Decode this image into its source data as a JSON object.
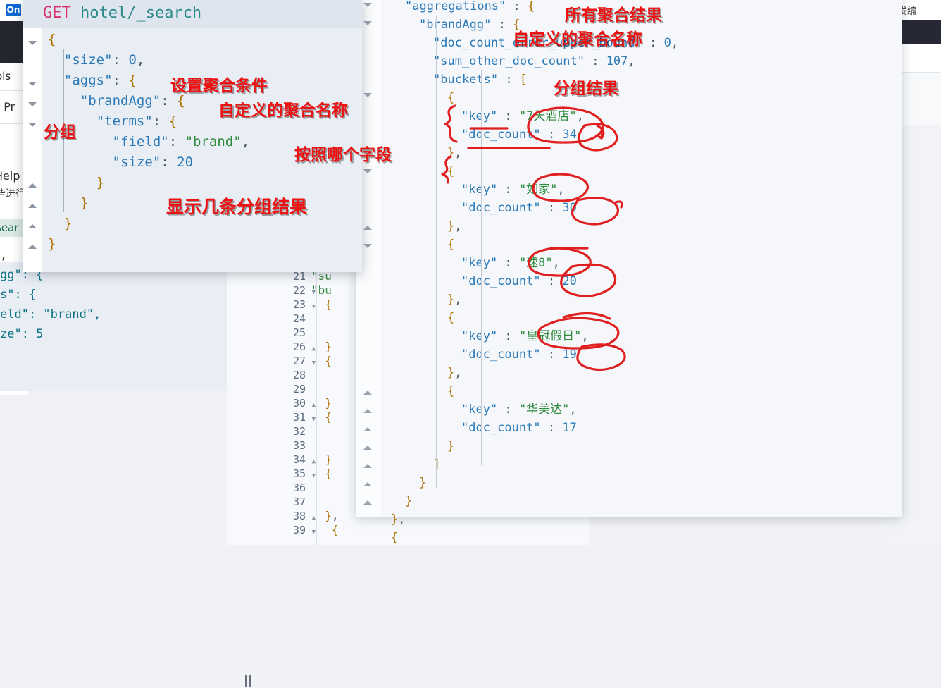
{
  "background_left_window": {
    "badge_label": "On",
    "menu_tools": "ols",
    "menu_profiler": "h Pr",
    "help_label": "Help",
    "cn_text": "些进行",
    "highlight_text": "sear",
    "comma": ","
  },
  "background_right_window": {
    "tab_label": "并发编"
  },
  "request_window": {
    "title_method": "GET",
    "title_path": " hotel/_search",
    "lines": [
      "{",
      "  \"size\": 0,",
      "  \"aggs\": {",
      "    \"brandAgg\": {",
      "      \"terms\": {",
      "        \"field\": \"brand\",",
      "        \"size\": 20",
      "      }",
      "    }",
      "  }",
      "}"
    ],
    "field_value": "brand",
    "size_value": "20",
    "top_size_value": "0"
  },
  "left_code_fragment": {
    "lines": [
      "gg\": {",
      "s\": {",
      "eld\": \"brand\",",
      "ze\": 5"
    ],
    "size_value": "5",
    "field_value": "brand"
  },
  "center_editor": {
    "line_numbers": [
      "21",
      "22",
      "23",
      "24",
      "25",
      "26",
      "27",
      "28",
      "29",
      "30",
      "31",
      "32",
      "33",
      "34",
      "35",
      "36",
      "37",
      "38",
      "39"
    ],
    "fold_markers": {
      "22": "down",
      "23": "down",
      "26": "up",
      "27": "down",
      "30": "up",
      "31": "down",
      "34": "up",
      "35": "down",
      "38": "up",
      "39": "down"
    },
    "code_lines": [
      "\"su",
      "\"bu",
      "  {",
      "",
      "",
      "  }",
      "  {",
      "",
      "",
      "  }",
      "  {",
      "",
      "",
      "  }",
      "  {",
      "",
      "",
      "  },",
      "   {"
    ]
  },
  "response": {
    "aggregations_key": "\"aggregations\"",
    "brand_agg_key": "\"brandAgg\"",
    "doc_count_error_upper_bound_key": "\"doc_count_error_upper_bound\"",
    "doc_count_error_upper_bound_value": "0",
    "sum_other_doc_count_key": "\"sum_other_doc_count\"",
    "sum_other_doc_count_value": "107",
    "buckets_key": "\"buckets\"",
    "key_label": "\"key\"",
    "doc_count_label": "\"doc_count\"",
    "buckets": [
      {
        "key": "\"7天酒店\"",
        "doc_count": "34"
      },
      {
        "key": "\"如家\"",
        "doc_count": "30"
      },
      {
        "key": "\"速8\"",
        "doc_count": "20"
      },
      {
        "key": "\"皇冠假日\"",
        "doc_count": "19"
      },
      {
        "key": "\"华美达\"",
        "doc_count": "17"
      }
    ]
  },
  "annotations": [
    {
      "id": "set-agg-condition",
      "text": "设置聚合条件"
    },
    {
      "id": "custom-agg-name-left",
      "text": "自定义的聚合名称"
    },
    {
      "id": "group-by",
      "text": "分组"
    },
    {
      "id": "which-field",
      "text": "按照哪个字段"
    },
    {
      "id": "how-many-results",
      "text": "显示几条分组结果"
    },
    {
      "id": "all-agg-results",
      "text": "所有聚合结果"
    },
    {
      "id": "custom-agg-name-right",
      "text": "自定义的聚合名称"
    },
    {
      "id": "group-results",
      "text": "分组结果"
    }
  ],
  "colors": {
    "annotation_red": "#ee1111",
    "ink_red": "#e02020",
    "key_blue": "#2b7ab8",
    "string_green": "#2e8b3d",
    "method_pink": "#d6336c"
  }
}
